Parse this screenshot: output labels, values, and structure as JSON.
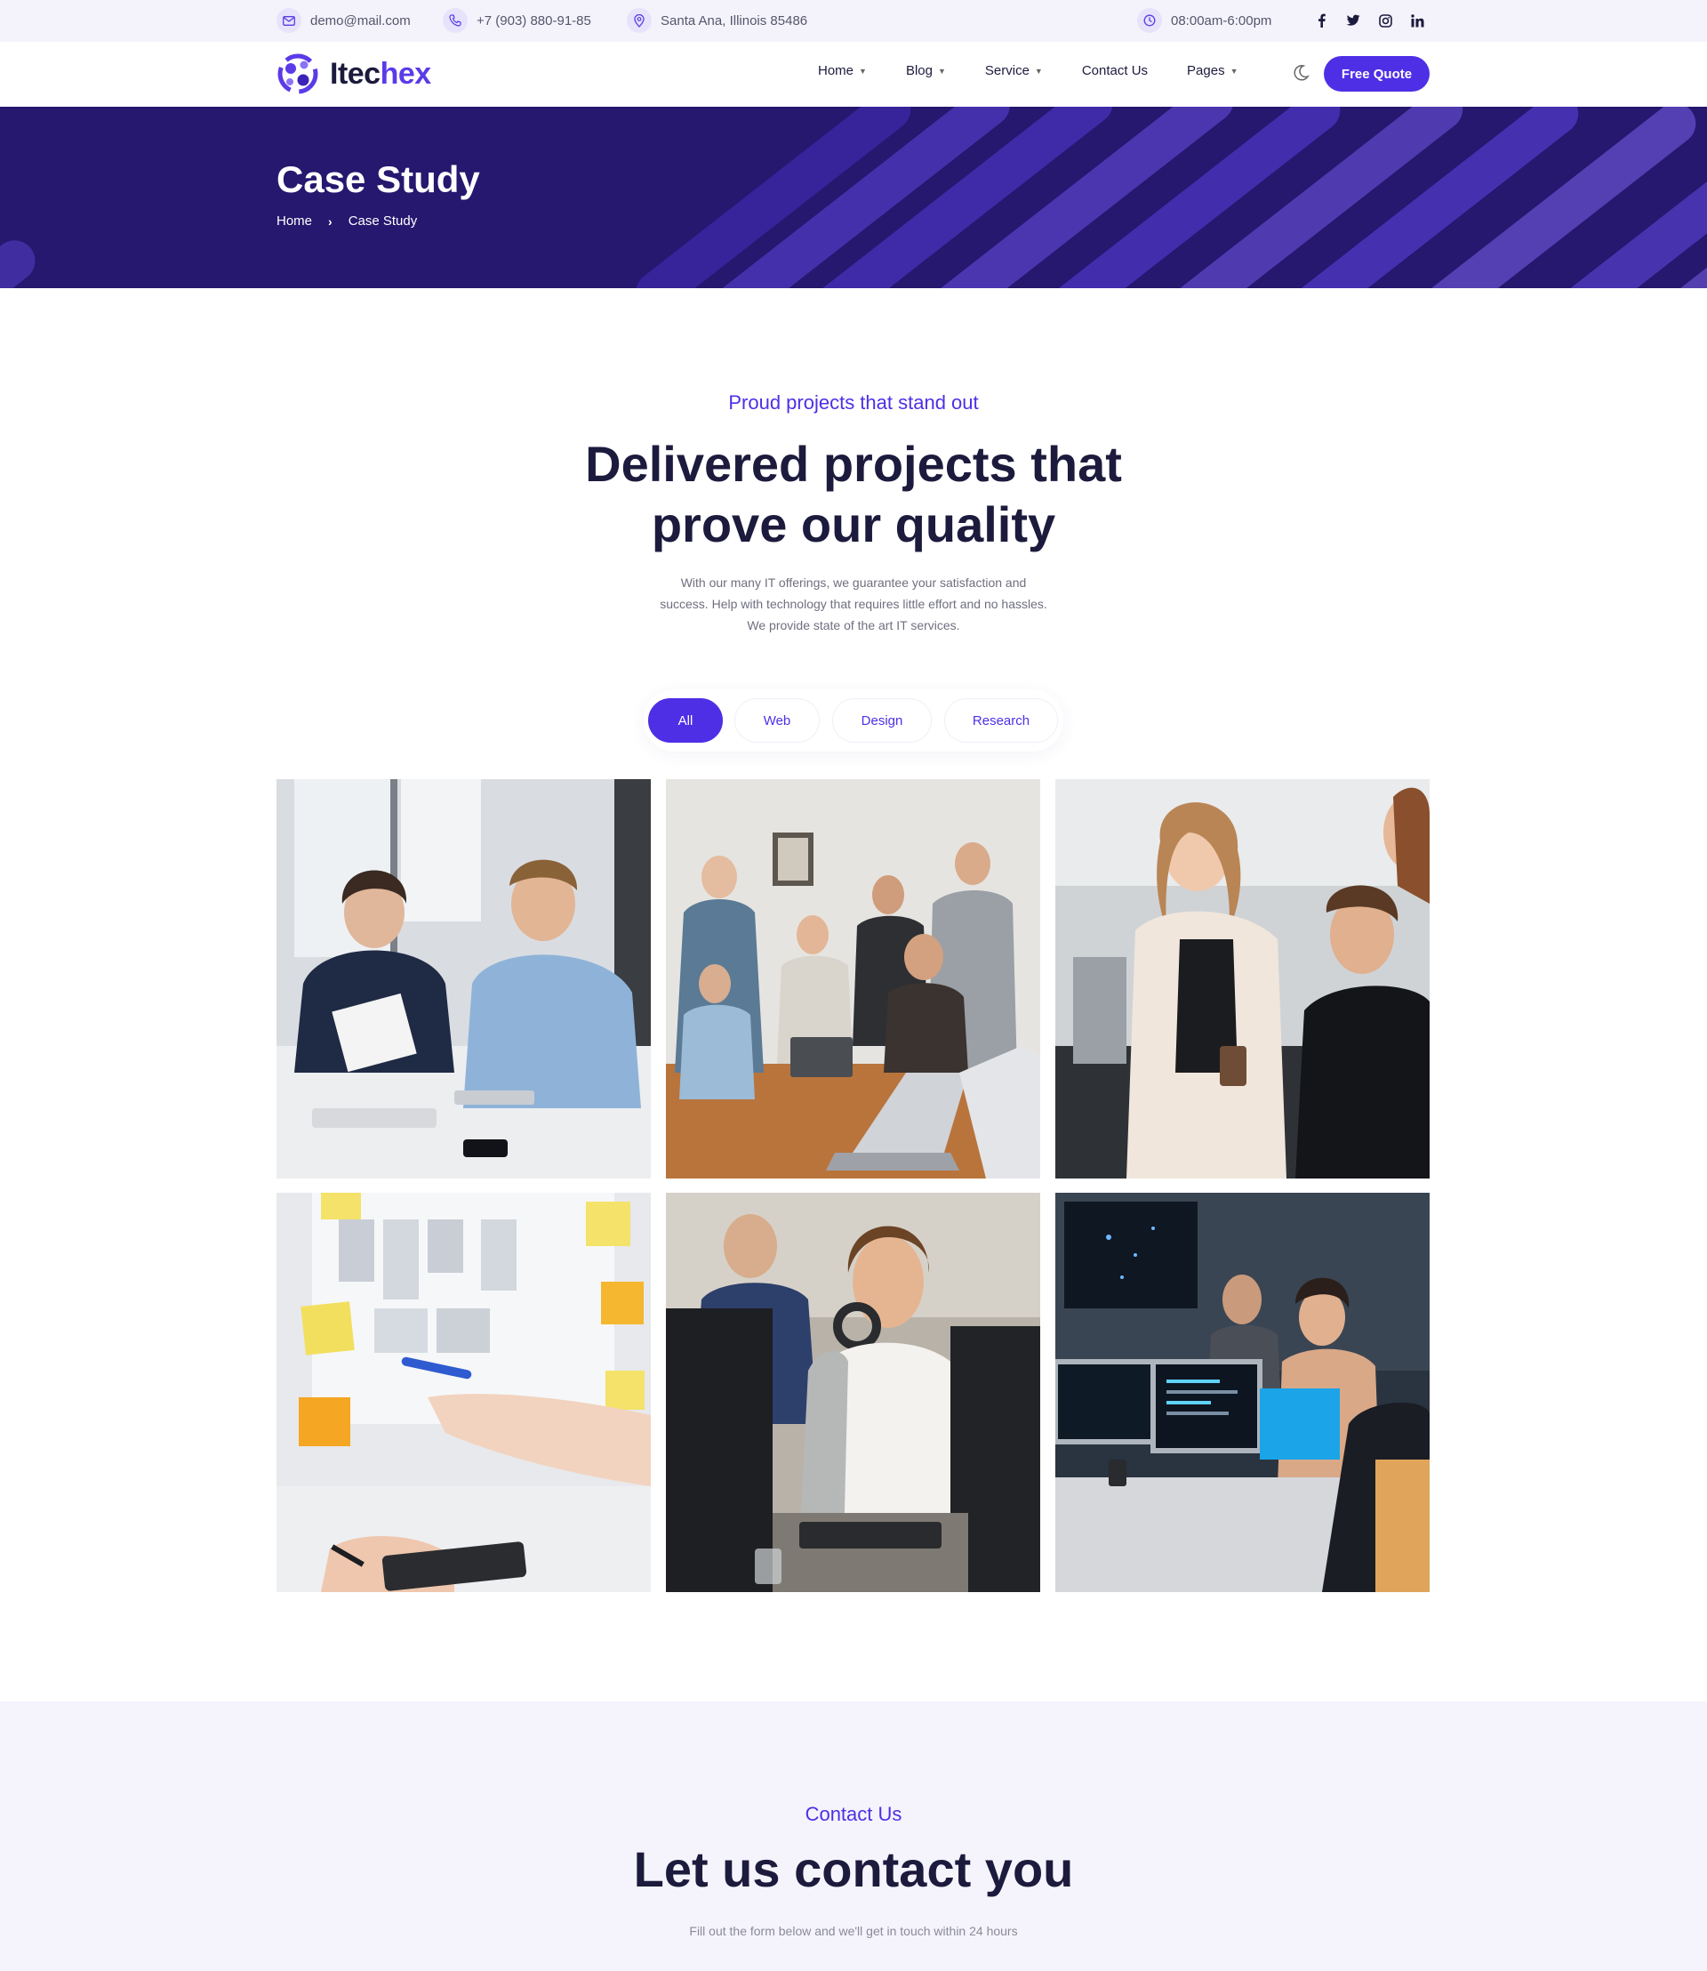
{
  "topbar": {
    "email": "demo@mail.com",
    "phone": "+7 (903) 880-91-85",
    "address": "Santa Ana, Illinois 85486",
    "hours": "08:00am-6:00pm",
    "socials": [
      "facebook-icon",
      "twitter-icon",
      "instagram-icon",
      "linkedin-icon"
    ]
  },
  "brand": {
    "name_part1": "Itec",
    "name_part2": "hex",
    "accent": "#4f2fe6"
  },
  "nav": {
    "items": [
      {
        "label": "Home",
        "dropdown": true
      },
      {
        "label": "Blog",
        "dropdown": true
      },
      {
        "label": "Service",
        "dropdown": true
      },
      {
        "label": "Contact Us",
        "dropdown": false
      },
      {
        "label": "Pages",
        "dropdown": true
      }
    ],
    "cta": "Free Quote"
  },
  "hero": {
    "title": "Case Study",
    "breadcrumb": [
      "Home",
      "Case Study"
    ],
    "background": "#26176f"
  },
  "projects": {
    "kicker": "Proud projects that stand out",
    "heading_line1": "Delivered projects that",
    "heading_line2": "prove our quality",
    "desc_line1": "With our many IT offerings, we guarantee your satisfaction and",
    "desc_line2": "success. Help with technology that requires little effort and no hassles.",
    "desc_line3": "We provide state of the art IT services.",
    "filters": [
      {
        "label": "All",
        "active": true
      },
      {
        "label": "Web",
        "active": false
      },
      {
        "label": "Design",
        "active": false
      },
      {
        "label": "Research",
        "active": false
      }
    ],
    "gallery": [
      "business-meeting-photo",
      "team-laptops-photo",
      "colleagues-coffee-photo",
      "whiteboard-sticky-notes-photo",
      "headset-woman-computer-photo",
      "developers-monitors-photo"
    ]
  },
  "contact": {
    "kicker": "Contact Us",
    "title": "Let us contact you",
    "subtitle": "Fill out the form below and we'll get in touch within 24 hours"
  }
}
